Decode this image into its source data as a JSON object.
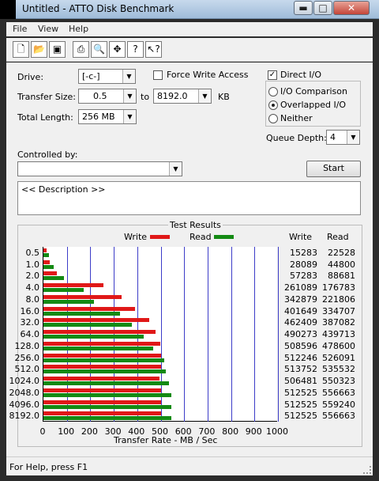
{
  "window": {
    "title": "Untitled - ATTO Disk Benchmark",
    "min": "▬",
    "max": "□",
    "close": "✕"
  },
  "menu": [
    "File",
    "View",
    "Help"
  ],
  "toolbar": {
    "icons": [
      "new-doc-icon",
      "open-folder-icon",
      "save-icon",
      "print-icon",
      "print-preview-icon",
      "move-icon",
      "help-icon",
      "context-help-icon"
    ]
  },
  "form": {
    "drive_label": "Drive:",
    "drive_value": "[-c-]",
    "force_write_label": "Force Write Access",
    "direct_io_label": "Direct I/O",
    "transfer_size_label": "Transfer Size:",
    "transfer_from": "0.5",
    "to_label": "to",
    "transfer_to": "8192.0",
    "kb_label": "KB",
    "total_length_label": "Total Length:",
    "total_length_value": "256 MB",
    "io_comparison_label": "I/O Comparison",
    "overlapped_io_label": "Overlapped I/O",
    "neither_label": "Neither",
    "queue_depth_label": "Queue Depth:",
    "queue_depth_value": "4",
    "controlled_by_label": "Controlled by:",
    "controlled_by_value": "",
    "start_label": "Start",
    "description": "<< Description >>"
  },
  "results": {
    "title": "Test Results",
    "write_legend": "Write",
    "read_legend": "Read",
    "write_col": "Write",
    "read_col": "Read",
    "xlabel": "Transfer Rate - MB / Sec",
    "colors": {
      "write": "#e01818",
      "read": "#148a14",
      "grid": "#3c3cc8"
    }
  },
  "chart_data": {
    "type": "bar",
    "orientation": "horizontal",
    "title": "Test Results",
    "xlabel": "Transfer Rate - MB / Sec",
    "xlim": [
      0,
      1000
    ],
    "xticks": [
      "0",
      "100",
      "200",
      "300",
      "400",
      "500",
      "600",
      "700",
      "800",
      "900",
      "1000"
    ],
    "categories": [
      "0.5",
      "1.0",
      "2.0",
      "4.0",
      "8.0",
      "16.0",
      "32.0",
      "64.0",
      "128.0",
      "256.0",
      "512.0",
      "1024.0",
      "2048.0",
      "4096.0",
      "8192.0"
    ],
    "write_kb": [
      "15283",
      "28089",
      "57283",
      "261089",
      "342879",
      "401649",
      "462409",
      "490273",
      "508596",
      "512246",
      "513752",
      "506481",
      "512525",
      "512525",
      "512525"
    ],
    "read_kb": [
      "22528",
      "44800",
      "88681",
      "176783",
      "221806",
      "334707",
      "387082",
      "439713",
      "478600",
      "526091",
      "535532",
      "550323",
      "556663",
      "559240",
      "556663"
    ],
    "series": [
      {
        "name": "Write",
        "values": [
          15,
          27,
          56,
          255,
          335,
          392,
          452,
          479,
          497,
          500,
          502,
          495,
          501,
          501,
          501
        ]
      },
      {
        "name": "Read",
        "values": [
          22,
          44,
          87,
          173,
          217,
          327,
          378,
          429,
          467,
          514,
          523,
          537,
          544,
          546,
          544
        ]
      }
    ],
    "legend": "top-center",
    "grid": true
  },
  "status": {
    "text": "For Help, press F1"
  }
}
